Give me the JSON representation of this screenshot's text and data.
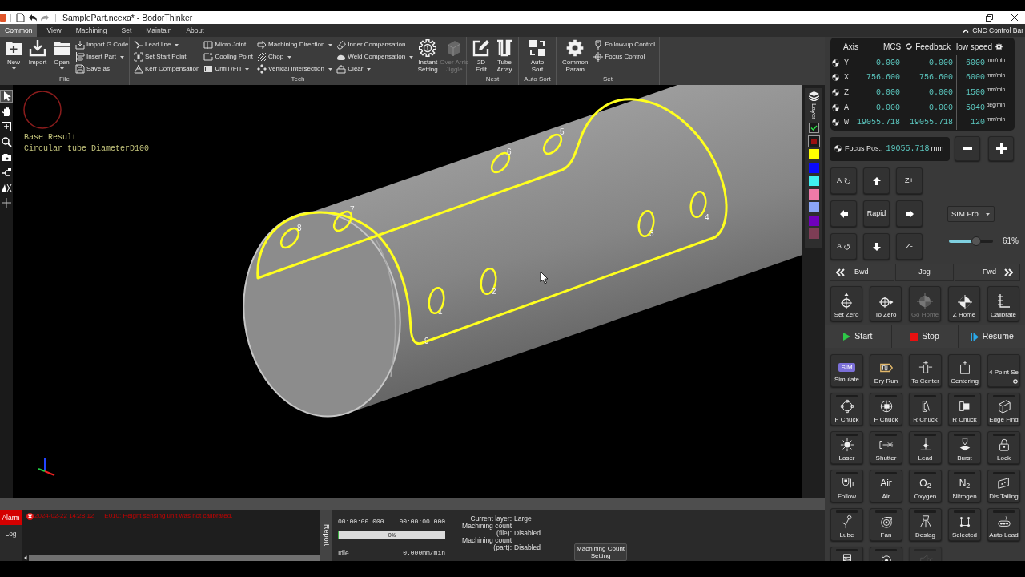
{
  "window": {
    "title": "SamplePart.ncexa* - BodorThinker"
  },
  "menu_tabs": [
    {
      "label": "Common",
      "selected": true
    },
    {
      "label": "View",
      "selected": false
    },
    {
      "label": "Machining",
      "selected": false
    },
    {
      "label": "Set",
      "selected": false
    },
    {
      "label": "Maintain",
      "selected": false
    },
    {
      "label": "About",
      "selected": false
    }
  ],
  "panel_toggle": {
    "label": "CNC Control Bar"
  },
  "ribbon": [
    {
      "title": "File",
      "items": [
        {
          "kind": "large",
          "lines": [
            "New"
          ],
          "dropdown": true,
          "disabled": false
        },
        {
          "kind": "large",
          "lines": [
            "Import"
          ],
          "dropdown": false,
          "disabled": false
        },
        {
          "kind": "large",
          "lines": [
            "Open"
          ],
          "dropdown": true,
          "disabled": false
        },
        {
          "kind": "column",
          "entries": [
            {
              "label": "Import G Code",
              "dropdown": false
            },
            {
              "label": "Insert Part",
              "dropdown": true
            },
            {
              "label": "Save as",
              "dropdown": false
            }
          ]
        }
      ]
    },
    {
      "title": "Tech",
      "items": [
        {
          "kind": "column",
          "entries": [
            {
              "label": "Lead line",
              "dropdown": true
            },
            {
              "label": "Set Start Point",
              "dropdown": false
            },
            {
              "label": "Kerf Compensation",
              "dropdown": false
            }
          ]
        },
        {
          "kind": "column",
          "entries": [
            {
              "label": "Micro Joint",
              "dropdown": false
            },
            {
              "label": "Cooling Point",
              "dropdown": false
            },
            {
              "label": "Unfill /Fill",
              "dropdown": true
            }
          ]
        },
        {
          "kind": "column",
          "entries": [
            {
              "label": "Machining Direction",
              "dropdown": true
            },
            {
              "label": "Chop",
              "dropdown": true
            },
            {
              "label": "Vertical Intersection",
              "dropdown": true
            }
          ]
        },
        {
          "kind": "column",
          "entries": [
            {
              "label": "Inner Compansation",
              "dropdown": false
            },
            {
              "label": "Weld Compensation",
              "dropdown": true
            },
            {
              "label": "Clear",
              "dropdown": true
            }
          ]
        },
        {
          "kind": "large",
          "lines": [
            "Instant",
            "Setting"
          ],
          "dropdown": false,
          "disabled": false
        },
        {
          "kind": "large",
          "lines": [
            "Over Arris",
            "Jiggle"
          ],
          "dropdown": false,
          "disabled": true
        }
      ]
    },
    {
      "title": "Nest",
      "items": [
        {
          "kind": "large",
          "lines": [
            "2D",
            "Edit"
          ],
          "dropdown": false,
          "disabled": false
        },
        {
          "kind": "large",
          "lines": [
            "Tube",
            "Array"
          ],
          "dropdown": false,
          "disabled": false
        }
      ]
    },
    {
      "title": "Auto Sort",
      "items": [
        {
          "kind": "large",
          "lines": [
            "Auto",
            "Sort"
          ],
          "dropdown": false,
          "disabled": false
        }
      ]
    },
    {
      "title": "Set",
      "items": [
        {
          "kind": "large",
          "lines": [
            "Common",
            "Param"
          ],
          "dropdown": false,
          "disabled": false
        },
        {
          "kind": "column",
          "entries": [
            {
              "label": "Follow-up Control",
              "dropdown": false
            },
            {
              "label": "Focus Control",
              "dropdown": false
            }
          ]
        }
      ]
    }
  ],
  "tool_strip": [
    {
      "selected": true
    },
    {
      "selected": false
    },
    {
      "selected": false
    },
    {
      "selected": false
    },
    {
      "selected": false
    },
    {
      "selected": false
    },
    {
      "selected": false
    },
    {
      "selected": false
    }
  ],
  "canvas": {
    "info_lines": [
      "Base Result",
      "Circular tube DiameterD100"
    ],
    "contour_labels": [
      "1",
      "2",
      "3",
      "4",
      "5",
      "6",
      "7",
      "8",
      "9"
    ]
  },
  "layer_panel": {
    "title": "Layer",
    "layers": [
      {
        "kind": "check"
      },
      {
        "kind": "framed",
        "color": "#9a1010"
      },
      {
        "kind": "swatch",
        "color": "#ffff00"
      },
      {
        "kind": "swatch",
        "color": "#0a0aff"
      },
      {
        "kind": "swatch",
        "color": "#3ff0f0"
      },
      {
        "kind": "swatch",
        "color": "#f07aa8"
      },
      {
        "kind": "swatch",
        "color": "#8ca6f8"
      },
      {
        "kind": "swatch",
        "color": "#7000bb"
      },
      {
        "kind": "swatch",
        "color": "#7e3d55"
      }
    ]
  },
  "log_panel": {
    "tabs": [
      {
        "label": "Alarm",
        "selected": true
      },
      {
        "label": "Log",
        "selected": false
      }
    ],
    "entries": [
      {
        "kind": "error",
        "time": "2024-02-22 14:28:12",
        "message": "E010: Height sensing unit was not calibrated."
      }
    ]
  },
  "report_tab": {
    "label": "Report"
  },
  "job_status": {
    "timers": [
      "00:00:00.000",
      "00:00:00.000"
    ],
    "progress": {
      "level": 0,
      "reading": "0%"
    },
    "state": "Idle",
    "feed_rate": "0.000mm/min"
  },
  "job_info": [
    {
      "label": "Current layer:",
      "value": "Large"
    },
    {
      "label": "Machining count (file):",
      "value": "Disabled"
    },
    {
      "label": "Machining count (part):",
      "value": "Disabled"
    }
  ],
  "count_setting_button": {
    "label": "Machining Count Setting"
  },
  "axis_panel": {
    "headers": [
      "Axis",
      "MCS",
      "Feedback",
      "low speed"
    ],
    "rows": [
      {
        "axis": "Y",
        "mcs": "0.000",
        "feedback": "0.000",
        "speed": "6000",
        "unit": "mm/min"
      },
      {
        "axis": "X",
        "mcs": "756.600",
        "feedback": "756.600",
        "speed": "6000",
        "unit": "mm/min"
      },
      {
        "axis": "Z",
        "mcs": "0.000",
        "feedback": "0.000",
        "speed": "1500",
        "unit": "mm/min"
      },
      {
        "axis": "A",
        "mcs": "0.000",
        "feedback": "0.000",
        "speed": "5040",
        "unit": "deg/min"
      },
      {
        "axis": "W",
        "mcs": "19055.718",
        "feedback": "19055.718",
        "speed": "120",
        "unit": "mm/min"
      }
    ]
  },
  "focus": {
    "label": "Focus Pos.:",
    "value": "19055.718",
    "unit": "mm"
  },
  "jog_pad": [
    {
      "kind": "rotate_ccw",
      "label": "A"
    },
    {
      "kind": "up"
    },
    {
      "kind": "text",
      "label": "Z+"
    },
    {
      "kind": "left"
    },
    {
      "kind": "text",
      "label": "Rapid"
    },
    {
      "kind": "right"
    },
    {
      "kind": "rotate_cw",
      "label": "A"
    },
    {
      "kind": "down"
    },
    {
      "kind": "text",
      "label": "Z-"
    }
  ],
  "frp_select": {
    "value": "SIM Frp"
  },
  "speed_slider": {
    "level": 0.61,
    "reading": "61%"
  },
  "jog_bar": [
    {
      "kind": "back",
      "label": "Bwd"
    },
    {
      "kind": "plain",
      "label": "Jog"
    },
    {
      "kind": "forward",
      "label": "Fwd"
    }
  ],
  "position_buttons": [
    {
      "label": "Set Zero",
      "disabled": false
    },
    {
      "label": "To Zero",
      "disabled": false
    },
    {
      "label": "Go Home",
      "disabled": true
    },
    {
      "label": "Z Home",
      "disabled": false
    },
    {
      "label": "Calibrate",
      "disabled": false
    }
  ],
  "run_controls": [
    {
      "kind": "start",
      "label": "Start"
    },
    {
      "kind": "stop",
      "label": "Stop"
    },
    {
      "kind": "resume",
      "label": "Resume"
    }
  ],
  "function_buttons": [
    {
      "kind": "action",
      "label": "Simulate",
      "badge": "SIM",
      "disabled": false
    },
    {
      "kind": "action",
      "label": "Dry Run",
      "disabled": false
    },
    {
      "kind": "action",
      "label": "To Center",
      "disabled": false
    },
    {
      "kind": "action",
      "label": "Centering",
      "disabled": false
    },
    {
      "kind": "action",
      "label": "4 Point Se",
      "disabled": false
    },
    {
      "kind": "toggle",
      "label": "F Chuck",
      "on": false,
      "disabled": false
    },
    {
      "kind": "toggle",
      "label": "F Chuck",
      "on": false,
      "disabled": false
    },
    {
      "kind": "toggle",
      "label": "R Chuck",
      "on": false,
      "disabled": false
    },
    {
      "kind": "toggle",
      "label": "R Chuck",
      "on": false,
      "disabled": false
    },
    {
      "kind": "toggle",
      "label": "Edge Find",
      "on": false,
      "disabled": false
    },
    {
      "kind": "toggle",
      "label": "Laser",
      "on": false,
      "disabled": false
    },
    {
      "kind": "toggle",
      "label": "Shutter",
      "on": false,
      "disabled": false
    },
    {
      "kind": "toggle",
      "label": "Lead",
      "on": false,
      "disabled": false
    },
    {
      "kind": "toggle",
      "label": "Burst",
      "on": false,
      "disabled": false
    },
    {
      "kind": "toggle",
      "label": "Lock",
      "on": false,
      "disabled": false
    },
    {
      "kind": "toggle",
      "label": "Follow",
      "on": false,
      "disabled": false
    },
    {
      "kind": "toggle",
      "label": "Air",
      "icon_text": "Air",
      "on": false,
      "disabled": false
    },
    {
      "kind": "toggle",
      "label": "Oxygen",
      "icon_text": "O$_{2}$",
      "on": false,
      "disabled": false
    },
    {
      "kind": "toggle",
      "label": "Nitrogen",
      "icon_text": "N$_{2}$",
      "on": false,
      "disabled": false
    },
    {
      "kind": "toggle",
      "label": "Dis Tailing",
      "on": false,
      "disabled": false
    },
    {
      "kind": "toggle",
      "label": "Lube",
      "on": false,
      "disabled": false
    },
    {
      "kind": "toggle",
      "label": "Fan",
      "on": false,
      "disabled": false
    },
    {
      "kind": "toggle",
      "label": "Deslag",
      "on": false,
      "disabled": false
    },
    {
      "kind": "toggle",
      "label": "Selected",
      "on": false,
      "disabled": false
    },
    {
      "kind": "toggle",
      "label": "Auto Load",
      "on": false,
      "disabled": false
    },
    {
      "kind": "toggle",
      "on": false,
      "disabled": false
    },
    {
      "kind": "toggle",
      "on": false,
      "disabled": false
    },
    {
      "kind": "toggle",
      "on": false,
      "disabled": true
    }
  ]
}
